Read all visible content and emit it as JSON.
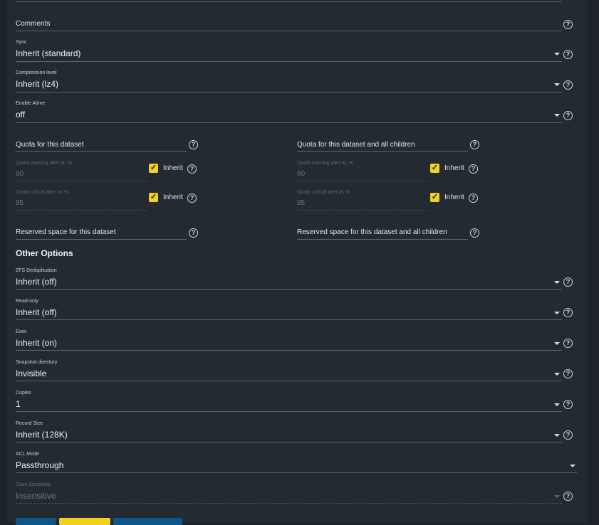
{
  "form": {
    "comments": {
      "label": "Comments"
    },
    "sync": {
      "label": "Sync",
      "value": "Inherit (standard)"
    },
    "compression": {
      "label": "Compression level",
      "value": "Inherit (lz4)"
    },
    "atime": {
      "label": "Enable Atime",
      "value": "off"
    },
    "quota_dataset": {
      "label": "Quota for this dataset",
      "warning": {
        "label": "Quota warning alert at, %",
        "value": "80",
        "inherit_label": "Inherit"
      },
      "critical": {
        "label": "Quota critical alert at, %",
        "value": "95",
        "inherit_label": "Inherit"
      }
    },
    "quota_children": {
      "label": "Quota for this dataset and all children",
      "warning": {
        "label": "Quota warning alert at, %",
        "value": "80",
        "inherit_label": "Inherit"
      },
      "critical": {
        "label": "Quota critical alert at, %",
        "value": "95",
        "inherit_label": "Inherit"
      }
    },
    "reserved_dataset": {
      "label": "Reserved space for this dataset"
    },
    "reserved_children": {
      "label": "Reserved space for this dataset and all children"
    },
    "other_options_title": "Other Options",
    "dedup": {
      "label": "ZFS Deduplication",
      "value": "Inherit (off)"
    },
    "readonly": {
      "label": "Read-only",
      "value": "Inherit (off)"
    },
    "exec": {
      "label": "Exec",
      "value": "Inherit (on)"
    },
    "snapdir": {
      "label": "Snapshot directory",
      "value": "Invisible"
    },
    "copies": {
      "label": "Copies",
      "value": "1"
    },
    "recordsize": {
      "label": "Record Size",
      "value": "Inherit (128K)"
    },
    "aclmode": {
      "label": "ACL Mode",
      "value": "Passthrough"
    },
    "casesens": {
      "label": "Case Sensitivity",
      "value": "Insensitive"
    }
  },
  "icons": {
    "help": "help-circle-icon",
    "caret": "dropdown-caret-icon",
    "check": "checkmark-icon"
  },
  "colors": {
    "accent": "#f0d21d",
    "primary_button": "#0d5689",
    "background": "#232a32"
  }
}
